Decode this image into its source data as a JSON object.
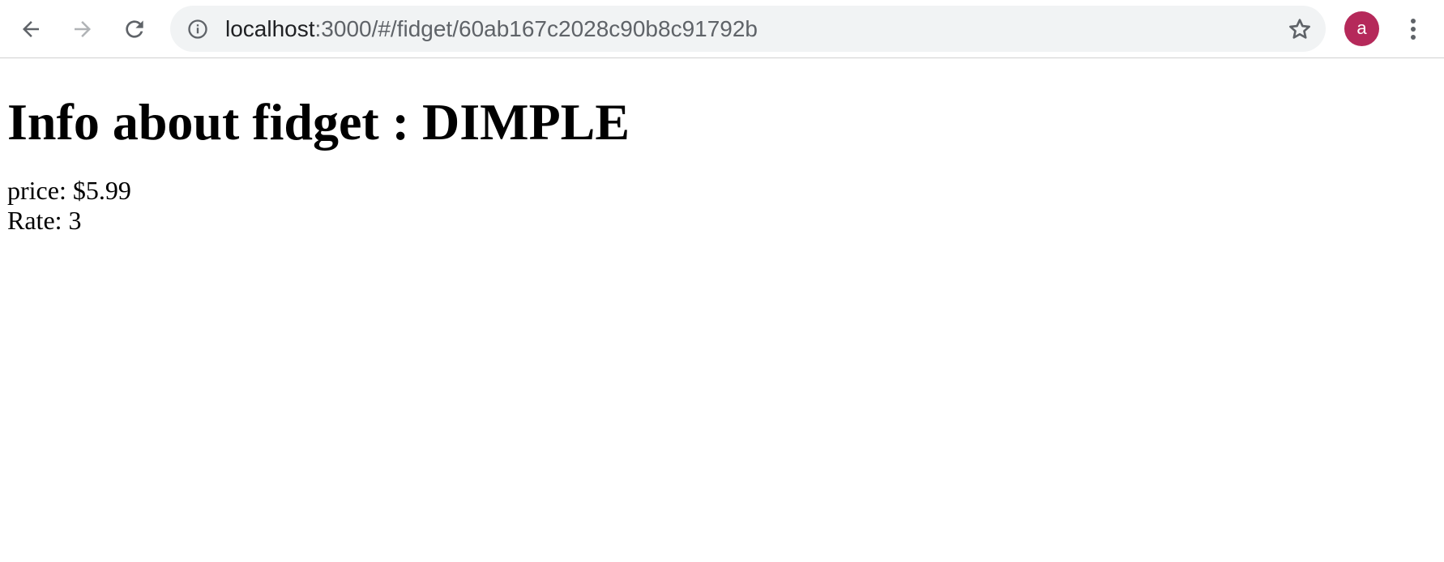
{
  "browser": {
    "url_host": "localhost",
    "url_path": ":3000/#/fidget/60ab167c2028c90b8c91792b",
    "avatar_letter": "a",
    "avatar_color": "#b5295a",
    "icons": {
      "back": "arrow-left-icon",
      "forward": "arrow-right-icon",
      "reload": "reload-icon",
      "site_info": "info-icon",
      "bookmark": "star-icon",
      "menu": "more-vertical-icon"
    }
  },
  "page": {
    "title": "Info about fidget : DIMPLE",
    "price_line": "price: $5.99",
    "rate_line": "Rate: 3"
  }
}
